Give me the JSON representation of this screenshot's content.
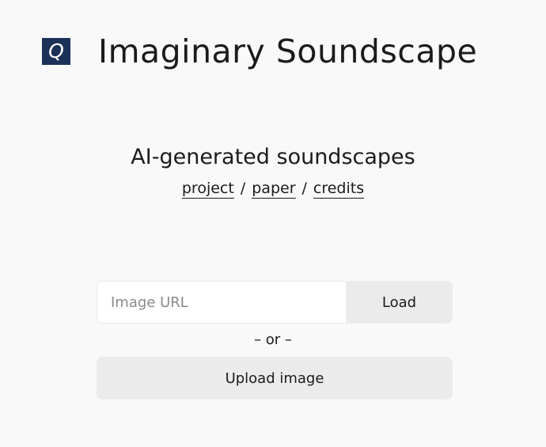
{
  "header": {
    "logo_letter": "Q",
    "title": "Imaginary Soundscape"
  },
  "hero": {
    "tagline": "AI-generated soundscapes",
    "links": [
      {
        "label": "project"
      },
      {
        "label": "paper"
      },
      {
        "label": "credits"
      }
    ],
    "separator": "/"
  },
  "form": {
    "url_placeholder": "Image URL",
    "url_value": "",
    "load_label": "Load",
    "or_text": "– or –",
    "upload_label": "Upload image"
  },
  "icons": {
    "logo": "q-logo-icon"
  },
  "colors": {
    "background": "#f9f9f9",
    "logo_bg": "#1c3157",
    "button_bg": "#ebebeb",
    "text": "#1b1b1b"
  }
}
